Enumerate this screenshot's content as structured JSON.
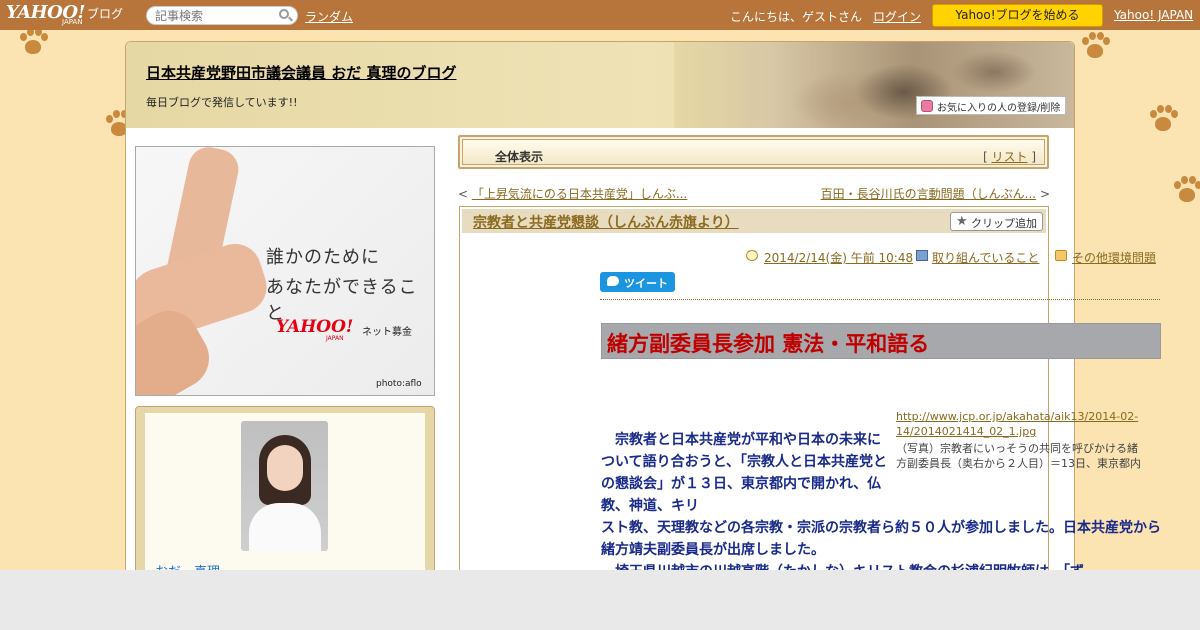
{
  "topbar": {
    "logo_text": "YAHOO!",
    "logo_suffix": "ブログ",
    "logo_japan": "JAPAN",
    "search_placeholder": "記事検索",
    "random_link": "ランダム",
    "greeting": "こんにちは、ゲストさん",
    "login_link": "ログイン",
    "start_button": "Yahoo!ブログを始める",
    "yahoo_japan_link": "Yahoo! JAPAN"
  },
  "header": {
    "blog_title": "日本共産党野田市議会議員 おだ 真理のブログ",
    "blog_subtitle": "毎日ブログで発信しています!!",
    "favorite_button": "お気に入りの人の登録/削除"
  },
  "sidebar": {
    "ad": {
      "line1": "誰かのために",
      "line2": "あなたができること",
      "logo": "YAHOO!",
      "logo_japan": "JAPAN",
      "service": "ネット募金",
      "credit": "photo:aflo"
    },
    "profile": {
      "name": "おだ　真理"
    }
  },
  "main": {
    "all_view_label": "全体表示",
    "list_open": "[ ",
    "list_link": "リスト",
    "list_close": " ]",
    "prev_arrow": "< ",
    "prev_link": "「上昇気流にのる日本共産党」しんぶ...",
    "next_link": "百田・長谷川氏の言動問題（しんぶん...",
    "next_arrow": " >",
    "article": {
      "title": "宗教者と共産党懇談（しんぶん赤旗より）",
      "clip_button": "クリップ追加",
      "date": "2014/2/14(金) 午前 10:48",
      "category1": "取り組んでいること",
      "category2": "その他環境問題",
      "tweet": "ツイート",
      "headline": "緒方副委員長参加 憲法・平和語る",
      "image_link": "http://www.jcp.or.jp/akahata/aik13/2014-02-14/2014021414_02_1.jpg",
      "caption": "（写真）宗教者にいっそうの共同を呼びかける緒方副委員長（奥右から２人目）＝13日、東京都内",
      "body_part1": "　宗教者と日本共産党が平和や日本の未来について語り合おうと、「宗教人と日本共産党との懇談会」が１３日、東京都内で開かれ、仏教、神道、キリ",
      "body_part2": "スト教、天理教などの各宗教・宗派の宗教者ら約５０人が参加しました。日本共産党から緒方靖夫副委員長が出席しました。",
      "body_part3": "　埼玉県川越市の川越高階（たかしな）キリスト教会の杉浦紀明牧師は、「ず"
    }
  }
}
